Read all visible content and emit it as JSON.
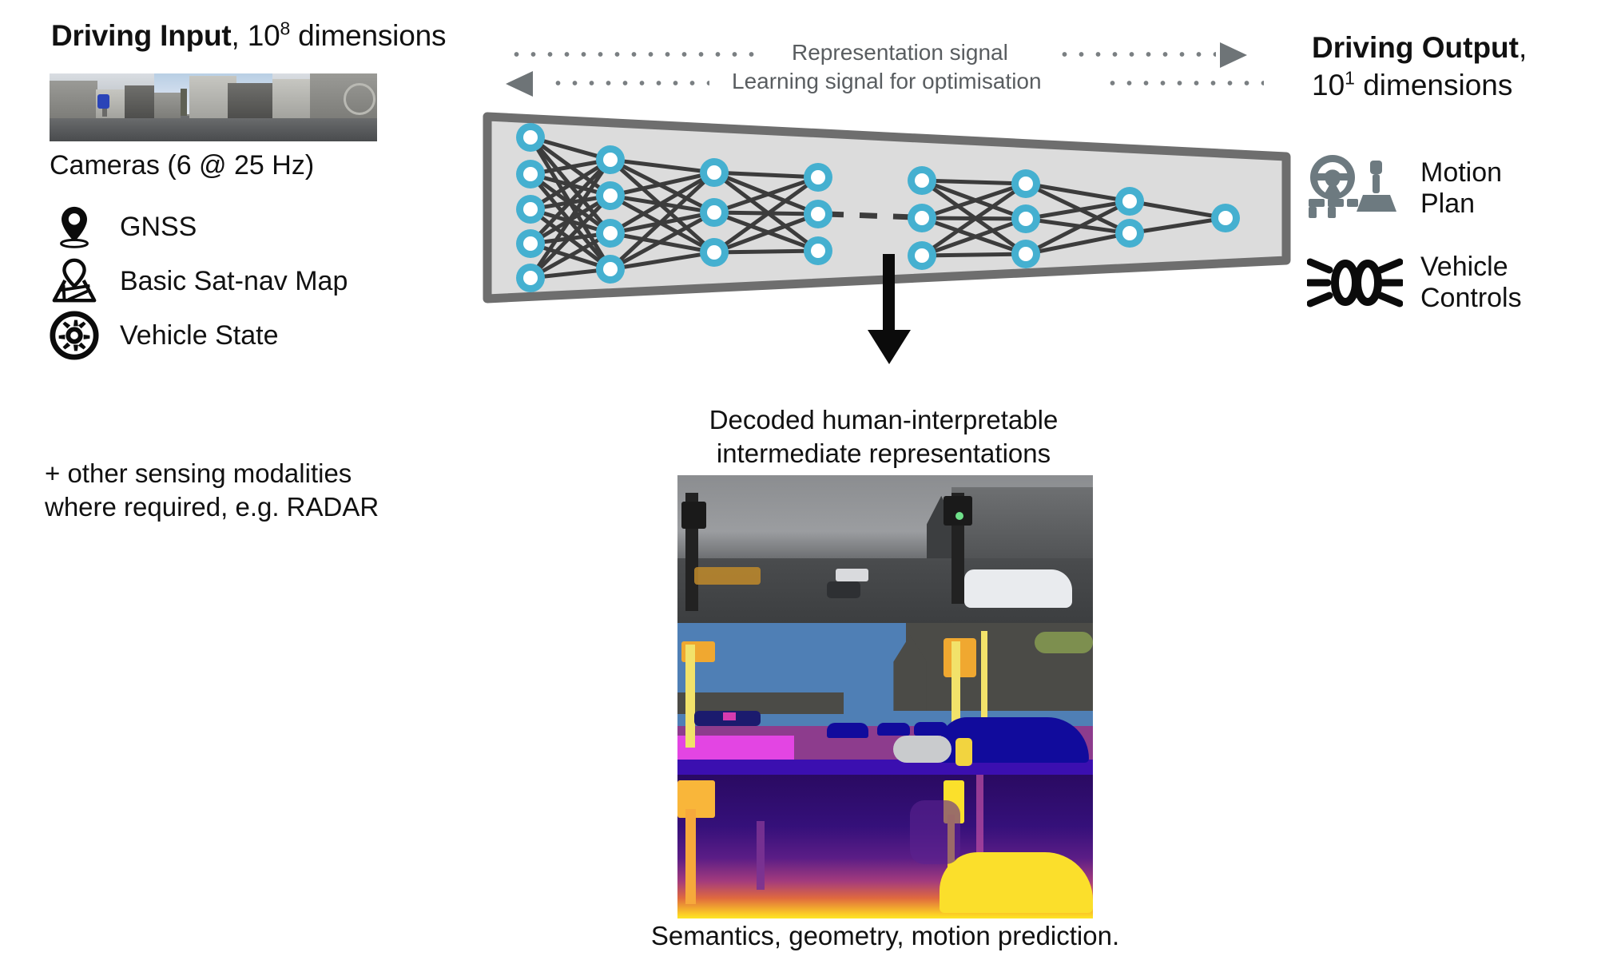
{
  "input": {
    "title_bold": "Driving Input",
    "title_rest": ", 10",
    "title_exp": "8",
    "title_tail": " dimensions",
    "cameras_label": "Cameras (6 @ 25 Hz)",
    "modalities": [
      {
        "icon": "location-pin-icon",
        "label": "GNSS"
      },
      {
        "icon": "map-icon",
        "label": "Basic Sat-nav Map"
      },
      {
        "icon": "wheel-gear-icon",
        "label": "Vehicle State"
      }
    ],
    "other_note": "+ other sensing modalities\nwhere required, e.g. RADAR"
  },
  "signals": {
    "representation": "Representation signal",
    "learning": "Learning signal for optimisation",
    "dot_color": "#7a7f82",
    "arrow_color": "#6e7477"
  },
  "network": {
    "node_fill": "#45B0D0",
    "node_inner": "#ffffff",
    "edge_color": "#3c3c3c",
    "panel_fill": "#dcdcdc",
    "panel_border": "#6e6e6e",
    "layers": [
      5,
      4,
      3,
      3,
      3,
      3,
      2,
      1
    ],
    "gap_after_layer": 4
  },
  "decoded": {
    "caption": "Decoded human-interpretable\nintermediate representations",
    "bottom_caption": "Semantics, geometry, motion prediction.",
    "panes": [
      "rgb-detection-image",
      "semantic-segmentation-image",
      "depth-map-image"
    ]
  },
  "output": {
    "title_bold": "Driving Output",
    "title_rest": ",",
    "title_line2_pre": "10",
    "title_exp": "1",
    "title_line2_tail": " dimensions",
    "items": [
      {
        "icon": "steering-wheel-gearshift-icon",
        "label": "Motion\nPlan",
        "color": "#6d7a80"
      },
      {
        "icon": "vehicle-lights-icon",
        "label": "Vehicle\nControls",
        "color": "#111111"
      }
    ]
  }
}
